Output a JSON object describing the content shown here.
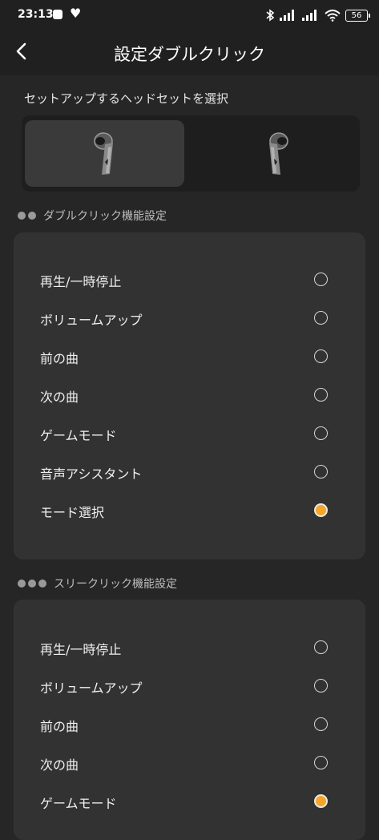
{
  "status": {
    "time": "23:13",
    "battery": "56"
  },
  "header": {
    "title": "設定ダブルクリック"
  },
  "select_label": "セットアップするヘッドセットを選択",
  "earbuds": {
    "selected": "left"
  },
  "double_click": {
    "title": "ダブルクリック機能設定",
    "options": [
      {
        "label": "再生/一時停止",
        "selected": false
      },
      {
        "label": "ボリュームアップ",
        "selected": false
      },
      {
        "label": "前の曲",
        "selected": false
      },
      {
        "label": "次の曲",
        "selected": false
      },
      {
        "label": "ゲームモード",
        "selected": false
      },
      {
        "label": "音声アシスタント",
        "selected": false
      },
      {
        "label": "モード選択",
        "selected": true
      }
    ]
  },
  "triple_click": {
    "title": "スリークリック機能設定",
    "options": [
      {
        "label": "再生/一時停止",
        "selected": false
      },
      {
        "label": "ボリュームアップ",
        "selected": false
      },
      {
        "label": "前の曲",
        "selected": false
      },
      {
        "label": "次の曲",
        "selected": false
      },
      {
        "label": "ゲームモード",
        "selected": true
      }
    ]
  },
  "colors": {
    "accent": "#f4a629",
    "background": "#262626",
    "card": "#323232"
  }
}
